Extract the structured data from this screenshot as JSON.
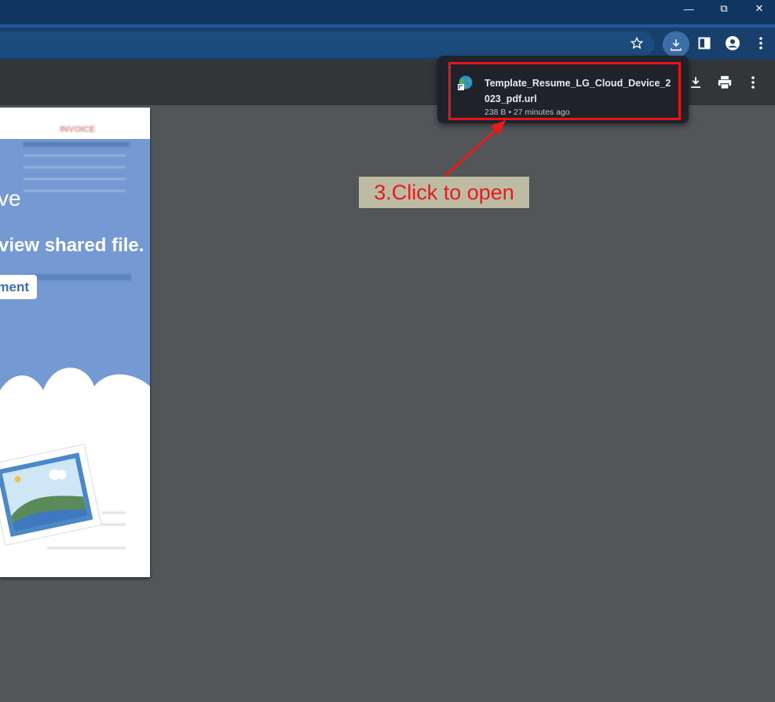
{
  "window": {
    "controls": {
      "minimize": "—",
      "restore": "⧉",
      "close": "✕"
    }
  },
  "toolbar": {
    "icons": [
      "star-icon",
      "download-icon",
      "side-panel-icon",
      "profile-icon",
      "menu-icon"
    ]
  },
  "pdf_toolbar": {
    "icons": [
      "download-icon",
      "print-icon",
      "more-icon"
    ]
  },
  "document": {
    "heading": "INVOICE",
    "line1": "ve",
    "line2": "view shared file.",
    "button_label": "ment"
  },
  "download_popup": {
    "file_name": "Template_Resume_LG_Cloud_Device_2023_pdf.url",
    "meta": "238 B • 27 minutes ago"
  },
  "annotation": {
    "text": "3.Click to open",
    "color": "#e81c1c"
  }
}
